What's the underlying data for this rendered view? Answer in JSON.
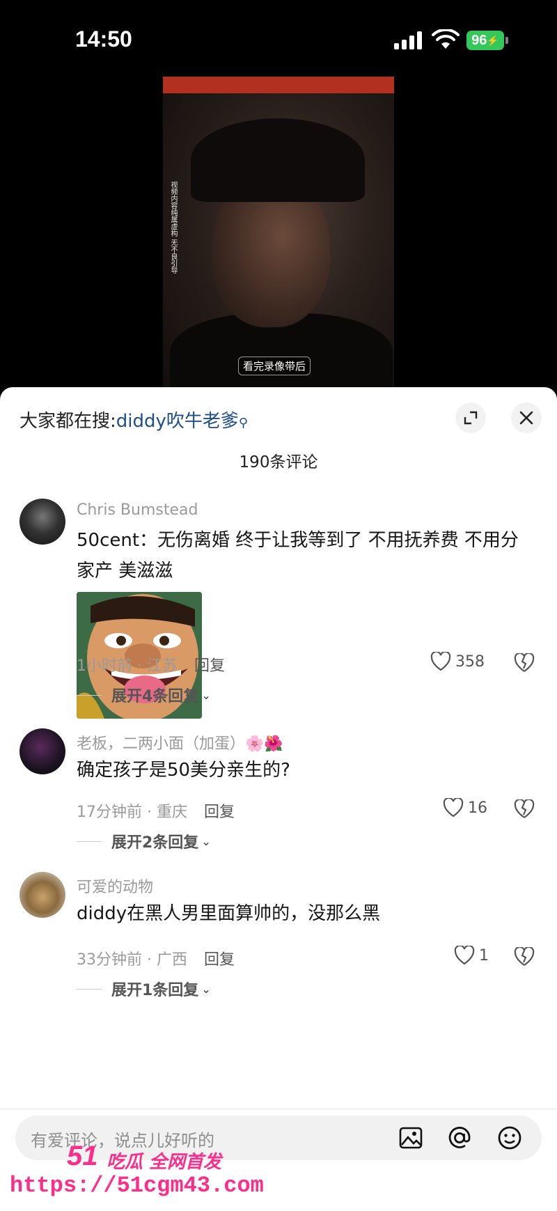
{
  "status": {
    "time": "14:50",
    "battery": "96"
  },
  "video": {
    "side_text": "视频内容纯属虚构 无不良引导",
    "subtitle": "看完录像带后"
  },
  "sheet": {
    "search_prefix": "大家都在搜:",
    "search_keyword": "diddy吹牛老爹",
    "comment_count": "190条评论"
  },
  "comments": [
    {
      "user": "Chris  Bumstead",
      "text": "50cent：无伤离婚 终于让我等到了 不用抚养费 不用分家产 美滋滋",
      "time_loc": "1小时前 · 江苏",
      "reply": "回复",
      "likes": "358",
      "expand": "展开4条回复"
    },
    {
      "user": "老板，二两小面（加蛋）🌸🌺",
      "text": "确定孩子是50美分亲生的?",
      "time_loc": "17分钟前 · 重庆",
      "reply": "回复",
      "likes": "16",
      "expand": "展开2条回复"
    },
    {
      "user": "可爱的动物",
      "text": "diddy在黑人男里面算帅的，没那么黑",
      "time_loc": "33分钟前 · 广西",
      "reply": "回复",
      "likes": "1",
      "expand": "展开1条回复"
    }
  ],
  "input": {
    "placeholder": "有爱评论，说点儿好听的"
  },
  "watermark": {
    "logo": "51",
    "tagline": "吃瓜 全网首发",
    "url": "https://51cgm43.com"
  },
  "colors": {
    "accent_link": "#1f4e8c",
    "battery": "#34c759",
    "watermark": "#ff2d8a"
  }
}
